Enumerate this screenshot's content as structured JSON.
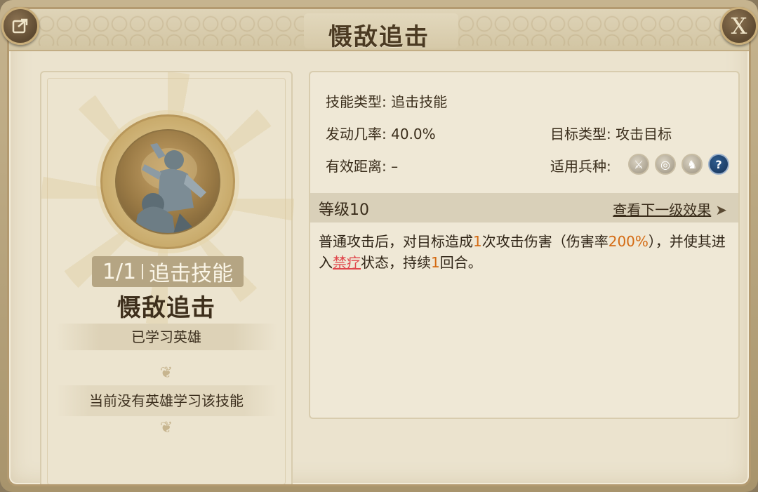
{
  "header": {
    "title": "慑敌追击",
    "share_icon": "share-icon",
    "close_label": "X"
  },
  "left": {
    "tag_count": "1/1",
    "tag_type": "追击技能",
    "skill_name": "慑敌追击",
    "learned_label": "已学习英雄",
    "none_label": "当前没有英雄学习该技能"
  },
  "info": {
    "skill_type_label": "技能类型:",
    "skill_type_value": "追击技能",
    "trigger_rate_label": "发动几率:",
    "trigger_rate_value": "40.0%",
    "target_type_label": "目标类型:",
    "target_type_value": "攻击目标",
    "range_label": "有效距离:",
    "range_value": "–",
    "troop_label": "适用兵种:",
    "troop_icons": [
      "sword-icon",
      "bow-target-icon",
      "horse-icon",
      "question-icon"
    ]
  },
  "level": {
    "label": "等级10",
    "next_link": "查看下一级效果"
  },
  "description": {
    "p1": "普通攻击后，对目标造成",
    "n1": "1",
    "p2": "次攻击伤害（伤害率",
    "n2": "200%",
    "p3": "），并使其进入",
    "status": "禁疗",
    "p4": "状态，持续",
    "n3": "1",
    "p5": "回合。"
  },
  "colors": {
    "highlight_orange": "#d46a12",
    "highlight_red": "#e0474c",
    "panel_bg": "#ebe3ce"
  }
}
